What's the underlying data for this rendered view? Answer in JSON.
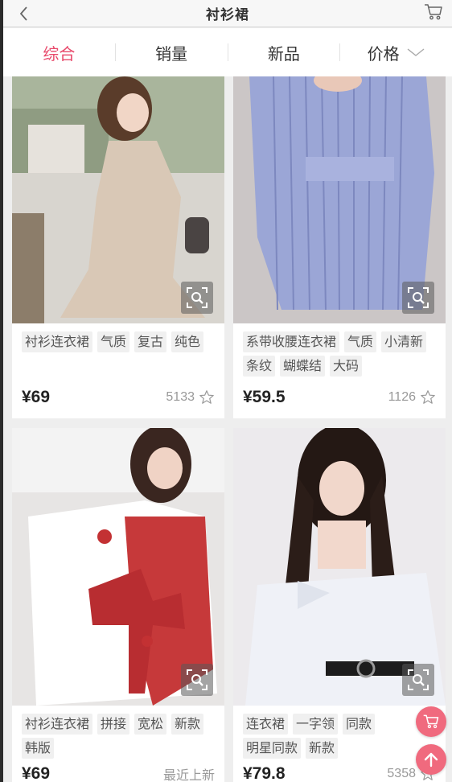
{
  "header": {
    "title": "衬衫裙",
    "back_icon": "chevron-left-icon",
    "cart_icon": "cart-icon"
  },
  "sort_tabs": [
    {
      "label": "综合",
      "active": true
    },
    {
      "label": "销量",
      "active": false
    },
    {
      "label": "新品",
      "active": false
    },
    {
      "label": "价格",
      "active": false
    }
  ],
  "colors": {
    "accent": "#e8496b",
    "fab": "#f06a7e"
  },
  "products": [
    {
      "tags": [
        "衬衫连衣裙",
        "气质",
        "复古",
        "纯色"
      ],
      "price": "¥69",
      "meta": "5133"
    },
    {
      "tags": [
        "系带收腰连衣裙",
        "气质",
        "小清新",
        "条纹",
        "蝴蝶结",
        "大码"
      ],
      "price": "¥59.5",
      "meta": "1126"
    },
    {
      "tags": [
        "衬衫连衣裙",
        "拼接",
        "宽松",
        "新款",
        "韩版"
      ],
      "price": "¥69",
      "meta": "最近上新"
    },
    {
      "tags": [
        "连衣裙",
        "一字领",
        "同款",
        "明星同款",
        "新款"
      ],
      "price": "¥79.8",
      "meta": "5358"
    }
  ],
  "fabs": {
    "cart_icon": "cart-icon",
    "top_icon": "arrow-up-icon"
  }
}
